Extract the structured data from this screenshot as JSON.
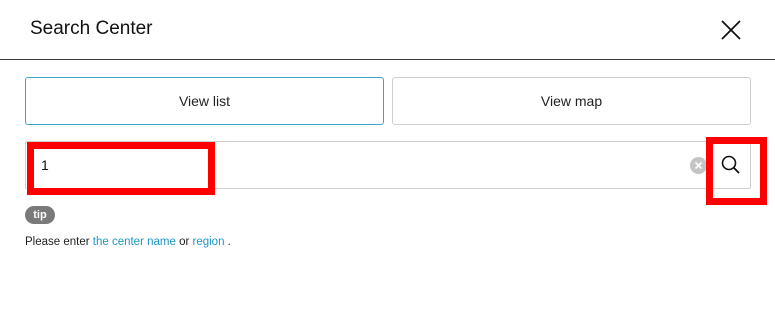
{
  "header": {
    "title": "Search Center",
    "close_icon": "close-icon"
  },
  "view_tabs": {
    "list_label": "View list",
    "map_label": "View map",
    "active": "list"
  },
  "search": {
    "value": "1",
    "clear_icon": "clear-icon",
    "search_icon": "search-icon"
  },
  "tip": {
    "badge": "tip",
    "text_prefix": "Please enter ",
    "link_center_name": "the center name",
    "text_or": " or ",
    "link_region": "region",
    "text_suffix": " ."
  },
  "colors": {
    "accent": "#3aa6c9",
    "link": "#1b95c9",
    "highlight": "#ff0000",
    "tip_badge": "#7a7a7a"
  }
}
